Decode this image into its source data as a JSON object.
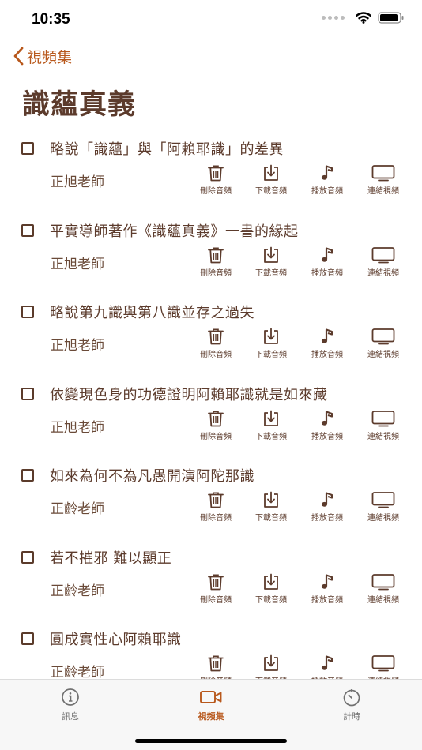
{
  "status": {
    "time": "10:35"
  },
  "nav": {
    "back_label": "視頻集"
  },
  "page": {
    "title": "識蘊真義"
  },
  "actions": {
    "delete": "刪除音頻",
    "download": "下載音頻",
    "play": "播放音頻",
    "link": "連結視頻"
  },
  "items": [
    {
      "title": "略說「識蘊」與「阿賴耶識」的差異",
      "teacher": "正旭老師"
    },
    {
      "title": "平實導師著作《識蘊真義》一書的緣起",
      "teacher": "正旭老師"
    },
    {
      "title": "略說第九識與第八識並存之過失",
      "teacher": "正旭老師"
    },
    {
      "title": "依變現色身的功德證明阿賴耶識就是如來藏",
      "teacher": "正旭老師"
    },
    {
      "title": "如來為何不為凡愚開演阿陀那識",
      "teacher": "正齡老師"
    },
    {
      "title": "若不摧邪 難以顯正",
      "teacher": "正齡老師"
    },
    {
      "title": "圓成實性心阿賴耶識",
      "teacher": "正齡老師"
    }
  ],
  "tabs": [
    {
      "label": "訊息",
      "icon": "info-icon"
    },
    {
      "label": "視頻集",
      "icon": "video-camera-icon",
      "active": true
    },
    {
      "label": "計時",
      "icon": "timer-icon"
    }
  ],
  "colors": {
    "accent": "#b8581c",
    "text": "#5c3b2c",
    "tab_inactive": "#707070"
  }
}
